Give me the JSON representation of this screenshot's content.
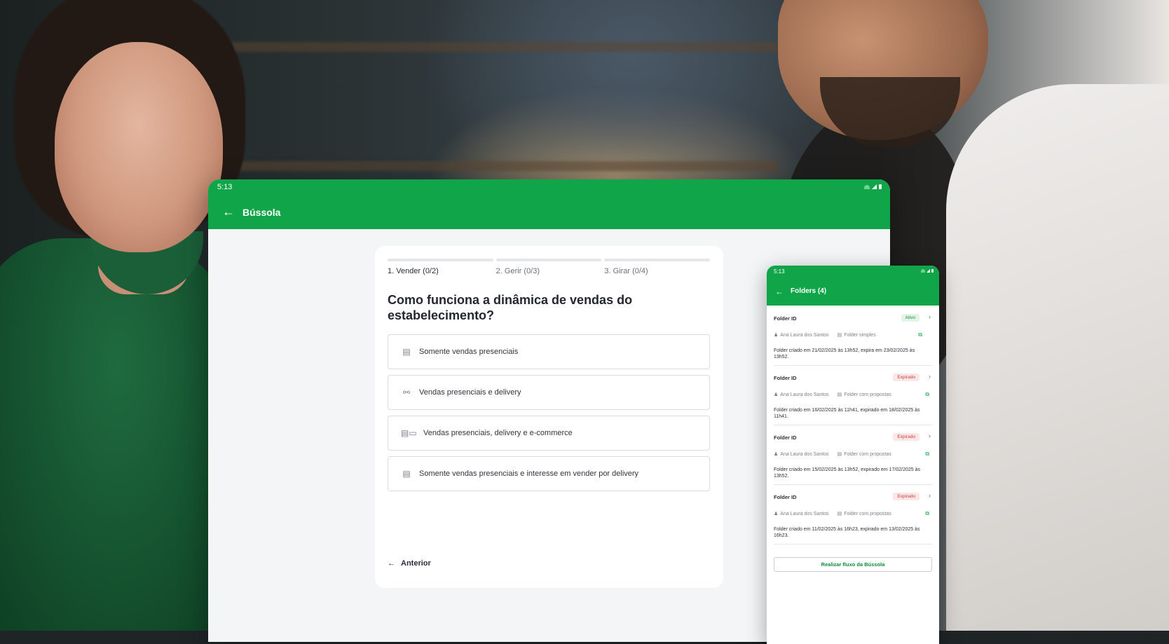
{
  "tablet": {
    "status_time": "5:13",
    "title": "Bússola",
    "steps": [
      {
        "label": "1. Vender (0/2)"
      },
      {
        "label": "2. Gerir (0/3)"
      },
      {
        "label": "3. Girar (0/4)"
      }
    ],
    "question": "Como funciona a dinâmica de vendas do estabelecimento?",
    "options": [
      {
        "label": "Somente vendas presenciais",
        "icon": "store-icon"
      },
      {
        "label": "Vendas presenciais e delivery",
        "icon": "scooter-icon"
      },
      {
        "label": "Vendas presenciais, delivery e e-commerce",
        "icon": "store-delivery-laptop-icon"
      },
      {
        "label": "Somente vendas presenciais e interesse em vender por delivery",
        "icon": "store-icon"
      }
    ],
    "previous_label": "Anterior"
  },
  "phone": {
    "status_time": "5:13",
    "title": "Folders (4)",
    "folders": [
      {
        "id": "Folder ID",
        "status": "Ativo",
        "owner": "Ana Laura dos Santos",
        "type": "Folder simples",
        "desc": "Folder criado em 21/02/2025 às 13h52, expira em 23/02/2025 às 13h52."
      },
      {
        "id": "Folder ID",
        "status": "Expirado",
        "owner": "Ana Laura dos Santos",
        "type": "Folder com propostas",
        "desc": "Folder criado em 16/02/2025 às 11h41, expirado em 18/02/2025 às 11h41."
      },
      {
        "id": "Folder ID",
        "status": "Expirado",
        "owner": "Ana Laura dos Santos",
        "type": "Folder com propostas",
        "desc": "Folder criado em 15/02/2025 às 13h52, expirado em 17/02/2025 às 13h52."
      },
      {
        "id": "Folder ID",
        "status": "Expirado",
        "owner": "Ana Laura dos Santos",
        "type": "Folder com propostas",
        "desc": "Folder criado em 11/02/2025 às 16h23, expirado em 13/02/2025 às 16h23."
      }
    ],
    "action_button": "Realizar fluxo da Bússola"
  },
  "colors": {
    "brand_green": "#0fa548",
    "active_badge": "#0f8a3c",
    "expired_badge": "#d23b3b"
  }
}
